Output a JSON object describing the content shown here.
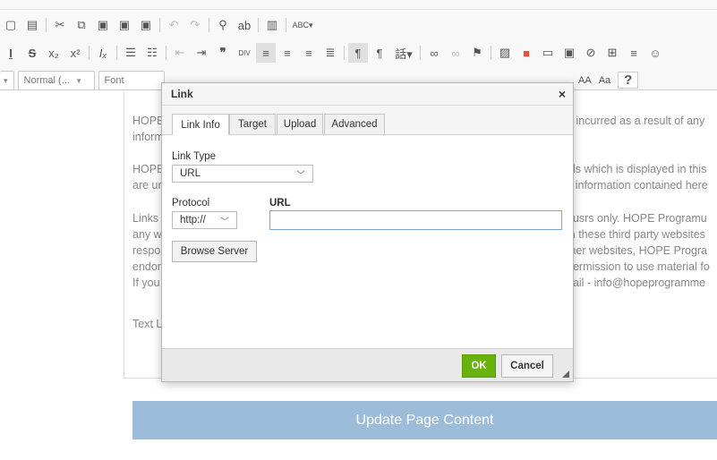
{
  "toolbar": {
    "row1_icons": [
      "new-page",
      "document",
      "cut",
      "copy",
      "paste",
      "paste-text",
      "paste-word",
      "undo",
      "redo",
      "find",
      "replace",
      "select-all",
      "spellcheck"
    ],
    "row2_icons": [
      "underline",
      "strikethrough",
      "subscript",
      "superscript",
      "remove-format",
      "numbered-list",
      "bulleted-list",
      "outdent",
      "indent",
      "blockquote",
      "create-div",
      "align-left",
      "align-center",
      "align-right",
      "justify",
      "ltr",
      "rtl",
      "language",
      "link",
      "unlink",
      "anchor",
      "image",
      "flash",
      "table",
      "horizontal-rule",
      "smiley"
    ],
    "format_select": "Normal (...",
    "font_select": "Font",
    "row3_tail": [
      "AA",
      "Aa",
      "?"
    ]
  },
  "content": {
    "p1_line1": "HOPE",
    "p1_line1_right": "e incurred as a result of any",
    "p1_line2": "inform",
    "p2_line1": "HOPE",
    "p2_line1_right": "als which is displayed in this",
    "p2_line2": "are ur",
    "p2_line2_right": "y information contained here",
    "p3_line1": "Links",
    "p3_line1_right": "f usrs only. HOPE Programu",
    "p3_line2": "any w",
    "p3_line2_right": "in these third party websites",
    "p3_line3": "respo",
    "p3_line3_right": "ther websites, HOPE Progra",
    "p3_line4": "endor",
    "p3_line4_right": "permission to use material fo",
    "p3_line5": "If you",
    "p3_line5_right": "nail - info@hopeprogramme",
    "p4_line1": "Text L"
  },
  "dialog": {
    "title": "Link",
    "close": "×",
    "tabs": [
      "Link Info",
      "Target",
      "Upload",
      "Advanced"
    ],
    "link_type_label": "Link Type",
    "link_type_value": "URL",
    "protocol_label": "Protocol",
    "protocol_value": "http://",
    "url_label": "URL",
    "url_value": "",
    "browse_label": "Browse Server",
    "ok_label": "OK",
    "cancel_label": "Cancel"
  },
  "update_button": "Update Page Content",
  "colors": {
    "ok": "#69b10b",
    "update": "#9dbcd9",
    "input_focus": "#7aa6d7"
  }
}
